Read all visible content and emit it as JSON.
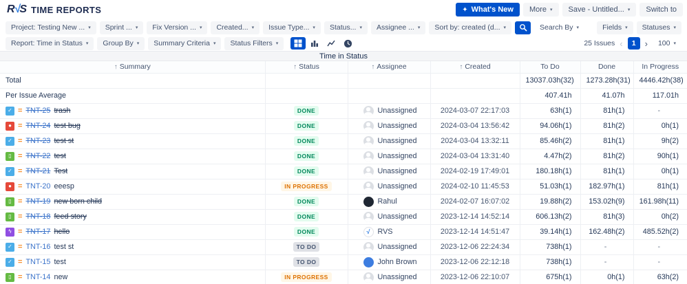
{
  "brand": {
    "logo_r": "R",
    "logo_v": "√",
    "logo_s": "S",
    "title": "TIME REPORTS"
  },
  "icons": {
    "sparkle": "✦",
    "chevron": "▾",
    "sort_asc": "↑",
    "prev": "‹",
    "next": "›"
  },
  "colors": {
    "accent": "#0052CC",
    "link": "#3B73CA",
    "chip_bg": "#F4F5F7",
    "border": "#EDEFF3"
  },
  "topbar": {
    "whats_new": "What's New",
    "more": "More",
    "save": "Save - Untitled...",
    "switch_to": "Switch to"
  },
  "filters_row1": {
    "left": [
      "Project: Testing New ...",
      "Sprint ...",
      "Fix Version ...",
      "Created...",
      "Issue Type...",
      "Status...",
      "Assignee ...",
      "Sort by: created (d..."
    ],
    "search_by": "Search By",
    "right": [
      "Fields",
      "Statuses"
    ]
  },
  "filters_row2": {
    "left": [
      "Report: Time in Status",
      "Group By",
      "Summary Criteria",
      "Status Filters"
    ],
    "active_view": "table",
    "issues_count": "25 Issues",
    "page": "1",
    "page_size": "100"
  },
  "priority": {
    "label": "Medium",
    "glyph": "=",
    "color": "#F79232"
  },
  "type_styles": {
    "task": {
      "color": "#4BADE8",
      "glyph": "✓"
    },
    "bug": {
      "color": "#E5493A",
      "glyph": "●"
    },
    "story": {
      "color": "#65BA43",
      "glyph": "▯"
    },
    "epic": {
      "color": "#904EE2",
      "glyph": "ϟ"
    }
  },
  "status_styles": {
    "done": {
      "fg": "#00875A",
      "bg": "#E3FCEF"
    },
    "inprogress": {
      "fg": "#DD7101",
      "bg": "#FFF6E6"
    },
    "todo": {
      "fg": "#44546F",
      "bg": "#DFE1E6"
    }
  },
  "table": {
    "title": "Time in Status",
    "columns": [
      {
        "label": "Summary",
        "sorted": true
      },
      {
        "label": "Status",
        "sorted": true
      },
      {
        "label": "Assignee",
        "sorted": true
      },
      {
        "label": "Created",
        "sorted": true
      },
      {
        "label": "To Do",
        "sorted": false
      },
      {
        "label": "Done",
        "sorted": false
      },
      {
        "label": "In Progress",
        "sorted": false
      }
    ],
    "summary_rows": [
      {
        "label": "Total",
        "todo": "13037.03h(32)",
        "done": "1273.28h(31)",
        "inprogress": "4446.42h(38)"
      },
      {
        "label": "Per Issue Average",
        "todo": "407.41h",
        "done": "41.07h",
        "inprogress": "117.01h"
      }
    ],
    "rows": [
      {
        "type": "task",
        "key": "TNT-25",
        "summary": "trash",
        "resolved": true,
        "status": "DONE",
        "status_kind": "done",
        "assignee": "Unassigned",
        "avatar_kind": "unassigned",
        "avatar_color": null,
        "created": "2024-03-07 22:17:03",
        "todo": "63h(1)",
        "done": "81h(1)",
        "inprogress": "-"
      },
      {
        "type": "bug",
        "key": "TNT-24",
        "summary": "test bug",
        "resolved": true,
        "status": "DONE",
        "status_kind": "done",
        "assignee": "Unassigned",
        "avatar_kind": "unassigned",
        "avatar_color": null,
        "created": "2024-03-04 13:56:42",
        "todo": "94.06h(1)",
        "done": "81h(2)",
        "inprogress": "0h(1)"
      },
      {
        "type": "task",
        "key": "TNT-23",
        "summary": "test st",
        "resolved": true,
        "status": "DONE",
        "status_kind": "done",
        "assignee": "Unassigned",
        "avatar_kind": "unassigned",
        "avatar_color": null,
        "created": "2024-03-04 13:32:11",
        "todo": "85.46h(2)",
        "done": "81h(1)",
        "inprogress": "9h(2)"
      },
      {
        "type": "story",
        "key": "TNT-22",
        "summary": "test",
        "resolved": true,
        "status": "DONE",
        "status_kind": "done",
        "assignee": "Unassigned",
        "avatar_kind": "unassigned",
        "avatar_color": null,
        "created": "2024-03-04 13:31:40",
        "todo": "4.47h(2)",
        "done": "81h(2)",
        "inprogress": "90h(1)"
      },
      {
        "type": "task",
        "key": "TNT-21",
        "summary": "Test",
        "resolved": true,
        "status": "DONE",
        "status_kind": "done",
        "assignee": "Unassigned",
        "avatar_kind": "unassigned",
        "avatar_color": null,
        "created": "2024-02-19 17:49:01",
        "todo": "180.18h(1)",
        "done": "81h(1)",
        "inprogress": "0h(1)"
      },
      {
        "type": "bug",
        "key": "TNT-20",
        "summary": "eeesp",
        "resolved": false,
        "status": "IN PROGRESS",
        "status_kind": "inprogress",
        "assignee": "Unassigned",
        "avatar_kind": "unassigned",
        "avatar_color": null,
        "created": "2024-02-10 11:45:53",
        "todo": "51.03h(1)",
        "done": "182.97h(1)",
        "inprogress": "81h(1)"
      },
      {
        "type": "story",
        "key": "TNT-19",
        "summary": "new born child",
        "resolved": true,
        "status": "DONE",
        "status_kind": "done",
        "assignee": "Rahul",
        "avatar_kind": "user",
        "avatar_color": "#1F2733",
        "created": "2024-02-07 16:07:02",
        "todo": "19.88h(2)",
        "done": "153.02h(9)",
        "inprogress": "161.98h(11)"
      },
      {
        "type": "story",
        "key": "TNT-18",
        "summary": "feed story",
        "resolved": true,
        "status": "DONE",
        "status_kind": "done",
        "assignee": "Unassigned",
        "avatar_kind": "unassigned",
        "avatar_color": null,
        "created": "2023-12-14 14:52:14",
        "todo": "606.13h(2)",
        "done": "81h(3)",
        "inprogress": "0h(2)"
      },
      {
        "type": "epic",
        "key": "TNT-17",
        "summary": "hello",
        "resolved": true,
        "status": "DONE",
        "status_kind": "done",
        "assignee": "RVS",
        "avatar_kind": "logo",
        "avatar_color": null,
        "created": "2023-12-14 14:51:47",
        "todo": "39.14h(1)",
        "done": "162.48h(2)",
        "inprogress": "485.52h(2)"
      },
      {
        "type": "task",
        "key": "TNT-16",
        "summary": "test st",
        "resolved": false,
        "status": "TO DO",
        "status_kind": "todo",
        "assignee": "Unassigned",
        "avatar_kind": "unassigned",
        "avatar_color": null,
        "created": "2023-12-06 22:24:34",
        "todo": "738h(1)",
        "done": "-",
        "inprogress": "-"
      },
      {
        "type": "task",
        "key": "TNT-15",
        "summary": "test",
        "resolved": false,
        "status": "TO DO",
        "status_kind": "todo",
        "assignee": "John Brown",
        "avatar_kind": "user",
        "avatar_color": "#3D7DE0",
        "created": "2023-12-06 22:12:18",
        "todo": "738h(1)",
        "done": "-",
        "inprogress": "-"
      },
      {
        "type": "story",
        "key": "TNT-14",
        "summary": "new",
        "resolved": false,
        "status": "IN PROGRESS",
        "status_kind": "inprogress",
        "assignee": "Unassigned",
        "avatar_kind": "unassigned",
        "avatar_color": null,
        "created": "2023-12-06 22:10:07",
        "todo": "675h(1)",
        "done": "0h(1)",
        "inprogress": "63h(2)"
      }
    ]
  }
}
